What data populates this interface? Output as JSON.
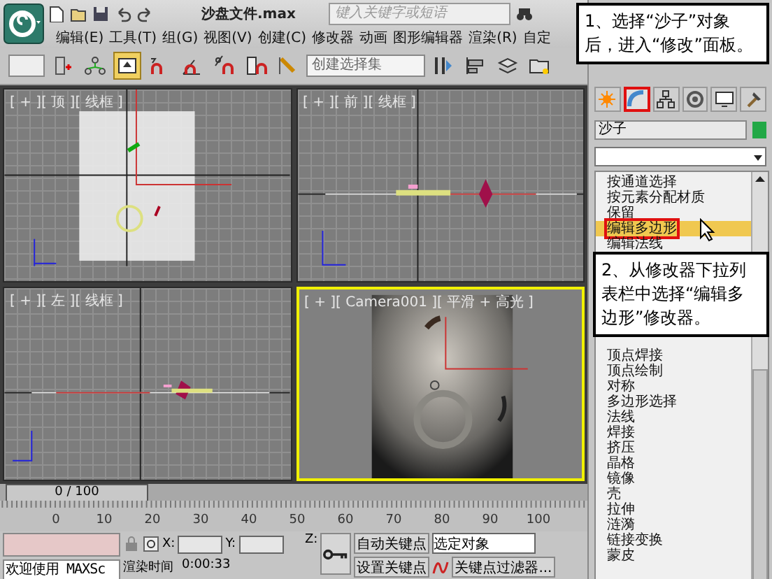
{
  "title_bar": {
    "title": "沙盘文件.max",
    "search_placeholder": "键入关键字或短语"
  },
  "menu": [
    "编辑(E)",
    "工具(T)",
    "组(G)",
    "视图(V)",
    "创建(C)",
    "修改器",
    "动画",
    "图形编辑器",
    "渲染(R)",
    "自定"
  ],
  "toolbar": {
    "selection_set": "创建选择集",
    "buttons": [
      {
        "kind": "link",
        "selected": false
      },
      {
        "kind": "hierarchy",
        "selected": false
      },
      {
        "kind": "select",
        "selected": true
      },
      {
        "kind": "snap",
        "selected": false
      },
      {
        "kind": "angle",
        "selected": false
      },
      {
        "kind": "percent",
        "selected": false
      },
      {
        "kind": "spinner",
        "selected": false
      },
      {
        "kind": "edit",
        "selected": false
      }
    ],
    "buttons_right": [
      {
        "kind": "mirror",
        "selected": false
      },
      {
        "kind": "align",
        "selected": false
      },
      {
        "kind": "layers",
        "selected": false
      },
      {
        "kind": "folder",
        "selected": false
      }
    ]
  },
  "viewports": [
    {
      "label": "[ + ][ 顶 ][ 线框 ]",
      "kind": "top",
      "active": false
    },
    {
      "label": "[ + ][ 前 ][ 线框 ]",
      "kind": "front",
      "active": false
    },
    {
      "label": "[ + ][ 左 ][ 线框 ]",
      "kind": "left",
      "active": false
    },
    {
      "label": "[ + ][ Camera001 ][ 平滑 + 高光 ]",
      "kind": "camera",
      "active": true
    }
  ],
  "timeline": {
    "frame": "0 / 100",
    "level": 0,
    "ticks": [
      "0",
      "10",
      "20",
      "30",
      "40",
      "50",
      "60",
      "70",
      "80",
      "90",
      "100"
    ]
  },
  "status": {
    "listener_text": "欢迎使用 MAXSc",
    "render_time": "渲染时间",
    "render_value": "0:00:33",
    "x_label": "X:",
    "y_label": "Y:",
    "z_label": "Z:",
    "auto_key": "自动关键点",
    "set_key": "设置关键点",
    "key_mode": "选定对象",
    "key_filters": "关键点过滤器..."
  },
  "command_panel": {
    "tabs": [
      {
        "kind": "create",
        "selected": false
      },
      {
        "kind": "modify",
        "selected": true
      },
      {
        "kind": "hierarchy",
        "selected": false
      },
      {
        "kind": "motion",
        "selected": false
      },
      {
        "kind": "display",
        "selected": false
      },
      {
        "kind": "utilities",
        "selected": false
      }
    ],
    "object_name": "沙子",
    "modifier_list_upper": [
      {
        "label": "按通道选择",
        "selected": false
      },
      {
        "label": "按元素分配材质",
        "selected": false
      },
      {
        "label": "保留",
        "selected": false
      },
      {
        "label": "编辑多边形",
        "selected": true
      },
      {
        "label": "编辑法线",
        "selected": false
      }
    ],
    "modifier_list_lower": [
      {
        "label": "顶点焊接",
        "selected": false
      },
      {
        "label": "顶点绘制",
        "selected": false
      },
      {
        "label": "对称",
        "selected": false
      },
      {
        "label": "多边形选择",
        "selected": false
      },
      {
        "label": "法线",
        "selected": false
      },
      {
        "label": "焊接",
        "selected": false
      },
      {
        "label": "挤压",
        "selected": false
      },
      {
        "label": "晶格",
        "selected": false
      },
      {
        "label": "镜像",
        "selected": false
      },
      {
        "label": "壳",
        "selected": false
      },
      {
        "label": "拉伸",
        "selected": false
      },
      {
        "label": "涟漪",
        "selected": false
      },
      {
        "label": "链接变换",
        "selected": false
      },
      {
        "label": "蒙皮",
        "selected": false
      }
    ]
  },
  "callouts": [
    {
      "text": "1、选择“沙子”对象后，进入“修改”面板。"
    },
    {
      "text": "2、从修改器下拉列表栏中选择“编辑多边形”修改器。"
    }
  ]
}
